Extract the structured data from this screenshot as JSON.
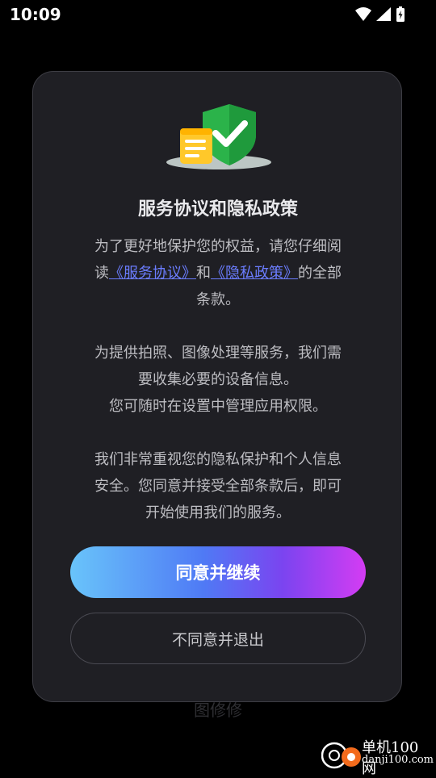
{
  "status_bar": {
    "time": "10:09",
    "icons": [
      "wifi-icon",
      "cellular-signal-icon",
      "battery-charging-icon"
    ]
  },
  "dialog": {
    "title": "服务协议和隐私政策",
    "paragraph1": {
      "line1": "为了更好地保护您的权益，请您仔细阅",
      "prefix": "读",
      "service_link": "《服务协议》",
      "connector": "和",
      "privacy_link": "《隐私政策》",
      "suffix": "的全部",
      "line3": "条款。"
    },
    "paragraph2": {
      "line1": "为提供拍照、图像处理等服务，我们需",
      "line2": "要收集必要的设备信息。",
      "line3": "您可随时在设置中管理应用权限。"
    },
    "paragraph3": {
      "line1": "我们非常重视您的隐私保护和个人信息",
      "line2": "安全。您同意并接受全部条款后，即可",
      "line3": "开始使用我们的服务。"
    },
    "agree_label": "同意并继续",
    "disagree_label": "不同意并退出"
  },
  "background": {
    "app_name": "图修修"
  },
  "watermark": {
    "title": "单机100网",
    "url": "danji100.com"
  },
  "colors": {
    "dialog_bg": "#1f1f24",
    "link": "#6b7dff",
    "shield_green": "#2bb34a",
    "document_yellow": "#ffc82a",
    "gradient_start": "#69c4fa",
    "gradient_end": "#d43cf3"
  }
}
